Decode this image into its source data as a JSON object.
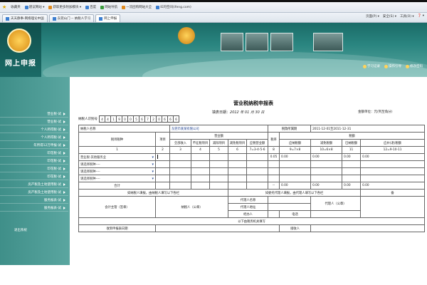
{
  "favorites_bar": {
    "label": "收藏夹",
    "items": [
      {
        "icon": "page-icon",
        "label": "建议网站 ▾"
      },
      {
        "icon": "page-icon",
        "label": "获取更多附加模块 ▾"
      },
      {
        "icon": "search-icon",
        "label": "百度"
      },
      {
        "icon": "page-icon",
        "label": "网站导航"
      },
      {
        "icon": "page-icon",
        "label": "一流团购网站大全"
      },
      {
        "icon": "page-icon",
        "label": "IE的空间(ifeng.com)"
      }
    ]
  },
  "tabs": [
    {
      "label": "天天静事-网络理论中国"
    },
    {
      "label": "东莞山门 -- 纳税人学习"
    },
    {
      "label": "网上申报",
      "active": true
    }
  ],
  "command_bar": [
    "页面(P) ▾",
    "安全(S) ▾",
    "工具(O) ▾",
    "❓ ▾"
  ],
  "header": {
    "logo_text": "网上申报",
    "top_links": [
      "学习记录",
      "操作引导",
      "修改密码"
    ]
  },
  "sidebar": {
    "items": [
      "营业税-试",
      "营业税-试",
      "个人所得税-试",
      "个人所得税-试",
      "年所得12万申报-试",
      "印花税-试",
      "印花税-试",
      "印花税-试",
      "印花税-试",
      "房产税及土地使用税-试",
      "房产税及土地使用税-试",
      "服务报表-试",
      "服务报表-试"
    ],
    "footer": "退出系统"
  },
  "form": {
    "title": "营业税纳税申报表",
    "fill_date_label": "填表日期：",
    "fill_date_value": "2012 年 01 月 30 日",
    "amount_unit": "金额单位：元(列至角分)",
    "taxpayer_id_label": "纳税人识别号",
    "taxpayer_id_digits": [
      "4",
      "4",
      "1",
      "9",
      "0",
      "0",
      "5",
      "6",
      "7",
      "2",
      "0",
      "6",
      "6",
      "6"
    ],
    "taxpayer_name_label": "纳税人名称",
    "taxpayer_name_value": "东莞市某某有限公司",
    "period_label": "税款所属期",
    "period_value": "2011-12-01至2011-12-31",
    "col_tax_item": "税目税种",
    "col_line_no": "项目",
    "col_group_revenue": "营业额",
    "col_group_tax": "税额",
    "revenue_cols": [
      "全部收入",
      "不征税项目",
      "减除项目",
      "减免税项目",
      "应税营业额"
    ],
    "rate_col": "税率",
    "tax_cols": [
      "应纳税额",
      "减免税额",
      "已纳税额",
      "应补(退)税额"
    ],
    "index_row": [
      "1",
      "2",
      "3",
      "4",
      "5",
      "6",
      "7=3-4-5-6",
      "8",
      "9=7×8",
      "10=6×8",
      "11",
      "12=9-10-11"
    ],
    "rows": [
      {
        "tax_item": "营业税-其他服务业",
        "rate": "0.05",
        "values": [
          "0.00",
          "0.00",
          "0.00",
          "0.00"
        ]
      },
      {
        "tax_item": "请选择税种----",
        "rate": "",
        "values": [
          "",
          "",
          "",
          ""
        ]
      },
      {
        "tax_item": "请选择税种----",
        "rate": "",
        "values": [
          "",
          "",
          "",
          ""
        ]
      },
      {
        "tax_item": "请选择税种----",
        "rate": "",
        "values": [
          "",
          "",
          "",
          ""
        ]
      }
    ],
    "total_label": "合计",
    "total_rate": "--",
    "total_values": [
      "0.00",
      "0.00",
      "0.00",
      "0.00"
    ],
    "declare_left": "如纳税人填报，由纳税人填写以下各栏",
    "declare_right": "如委托代理人填报，由代理人填写以下各栏",
    "declare_note": "备",
    "accountant_label": "会计主管（签章）",
    "taxpayer_sign_label": "纳税人（公章）",
    "agent_name_label": "代理人名称",
    "agent_address_label": "代理人地址",
    "agent_sign_label": "代理人（公章）",
    "handler_label": "经办人",
    "phone_label": "电话",
    "tax_office_label": "以下由税务机关填写",
    "receive_date_label": "收到申报表日期",
    "receiver_label": "接收人"
  }
}
